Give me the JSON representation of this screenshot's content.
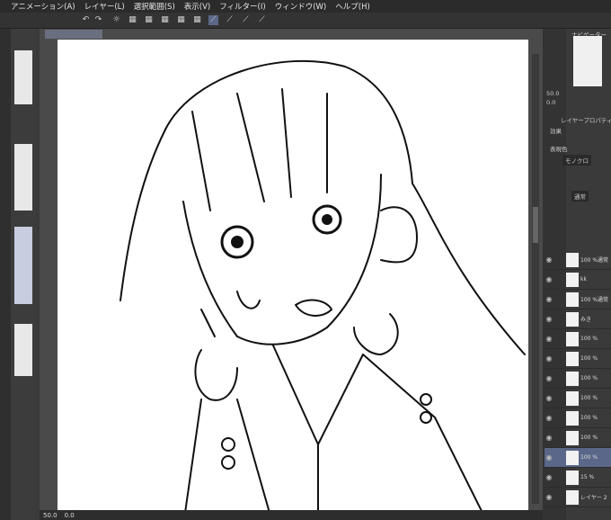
{
  "menu": [
    "アニメーション(A)",
    "レイヤー(L)",
    "選択範囲(S)",
    "表示(V)",
    "フィルター(I)",
    "ウィンドウ(W)",
    "ヘルプ(H)"
  ],
  "status": {
    "zoom": "50.0",
    "angle": "0.0"
  },
  "right_panel": {
    "navigator_title": "ナビゲーター",
    "nav_zoom": "50.0",
    "nav_angle": "0.0",
    "layer_prop_title": "レイヤープロパティ",
    "effect_label": "効果",
    "color_label": "表現色",
    "color_value": "モノクロ",
    "blend_mode": "通常"
  },
  "layers": [
    {
      "name": "100 %通常"
    },
    {
      "name": "kk"
    },
    {
      "name": "100 %通常"
    },
    {
      "name": "みき"
    },
    {
      "name": "100 %"
    },
    {
      "name": "100 %"
    },
    {
      "name": "100 %"
    },
    {
      "name": "100 %"
    },
    {
      "name": "100 %"
    },
    {
      "name": "100 %"
    },
    {
      "name": "100 %"
    },
    {
      "name": "15 %"
    },
    {
      "name": "レイヤー 2"
    }
  ]
}
